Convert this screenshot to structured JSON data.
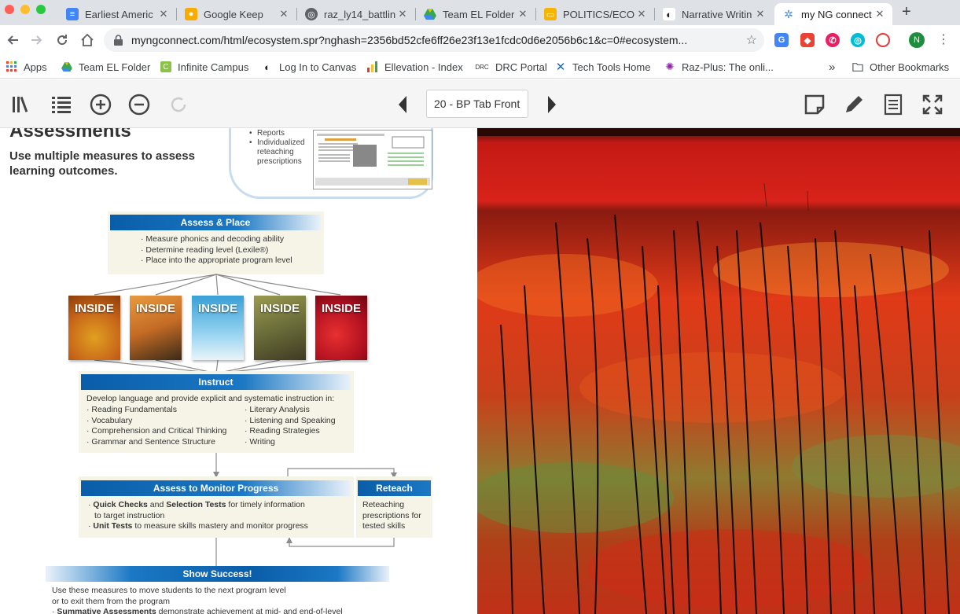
{
  "tabs": [
    {
      "title": "Earliest Americ",
      "icon": "docs-icon",
      "color": "#4285f4",
      "active": false
    },
    {
      "title": "Google Keep",
      "icon": "keep-icon",
      "color": "#f9ab00",
      "active": false
    },
    {
      "title": "raz_ly14_battlin",
      "icon": "globe-icon",
      "color": "#5f6368",
      "active": false
    },
    {
      "title": "Team EL Folder",
      "icon": "drive-icon",
      "color": "#34a853",
      "active": false
    },
    {
      "title": "POLITICS/ECON",
      "icon": "slides-icon",
      "color": "#f4b400",
      "active": false
    },
    {
      "title": "Narrative Writin",
      "icon": "canvas-icon",
      "color": "#333333",
      "active": false
    },
    {
      "title": "my NG connect",
      "icon": "ngconnect-icon",
      "color": "#4a90d9",
      "active": true
    }
  ],
  "new_tab_symbol": "+",
  "close_symbol": "✕",
  "url": "myngconnect.com/html/ecosystem.spr?nghash=2356bd52cfe6ff26e23f13e1fcdc0d6e2056b6c1&c=0#ecosystem...",
  "profile_initial": "N",
  "bookmarks": [
    {
      "label": "Apps",
      "icon": "apps-grid-icon"
    },
    {
      "label": "Team EL Folder",
      "icon": "drive-icon"
    },
    {
      "label": "Infinite Campus",
      "icon": "infinite-campus-icon"
    },
    {
      "label": "Log In to Canvas",
      "icon": "canvas-icon"
    },
    {
      "label": "Ellevation - Index",
      "icon": "ellevation-icon"
    },
    {
      "label": "DRC Portal",
      "icon": "drc-icon"
    },
    {
      "label": "Tech Tools Home",
      "icon": "confluence-icon"
    },
    {
      "label": "Raz-Plus: The onli...",
      "icon": "raz-icon"
    }
  ],
  "bookmarks_overflow": "»",
  "other_bookmarks": "Other Bookmarks",
  "reader": {
    "page_label": "20 - BP Tab Front"
  },
  "page": {
    "heading": "Assessments",
    "subtitle": "Use multiple measures to assess learning outcomes.",
    "reports_list": [
      "Reports",
      "Individualized reteaching prescriptions"
    ],
    "assess_place": {
      "title": "Assess & Place",
      "bullets": [
        "Measure phonics and decoding ability",
        "Determine reading level (Lexile®)",
        "Place into the appropriate program level"
      ]
    },
    "book_label": "INSIDE",
    "instruct": {
      "title": "Instruct",
      "intro": "Develop language and provide explicit and systematic instruction in:",
      "left": [
        "Reading Fundamentals",
        "Vocabulary",
        "Comprehension and Critical Thinking",
        "Grammar and Sentence Structure"
      ],
      "right": [
        "Literary Analysis",
        "Listening and Speaking",
        "Reading Strategies",
        "Writing"
      ]
    },
    "monitor": {
      "title": "Assess to Monitor Progress",
      "b1_bold1": "Quick Checks",
      "b1_mid": " and ",
      "b1_bold2": "Selection Tests",
      "b1_rest": " for timely information",
      "b1_line2": "to target instruction",
      "b2_bold": "Unit Tests",
      "b2_rest": " to measure skills mastery and monitor progress"
    },
    "reteach": {
      "title": "Reteach",
      "text": "Reteaching prescriptions for tested skills"
    },
    "show_success": {
      "title": "Show Success!",
      "line1": "Use these measures to move students to the next program level",
      "line2": "or to exit them from the program",
      "b_bold": "Summative Assessments",
      "b_rest": " demonstrate achievement at mid- and end-of-level"
    }
  }
}
